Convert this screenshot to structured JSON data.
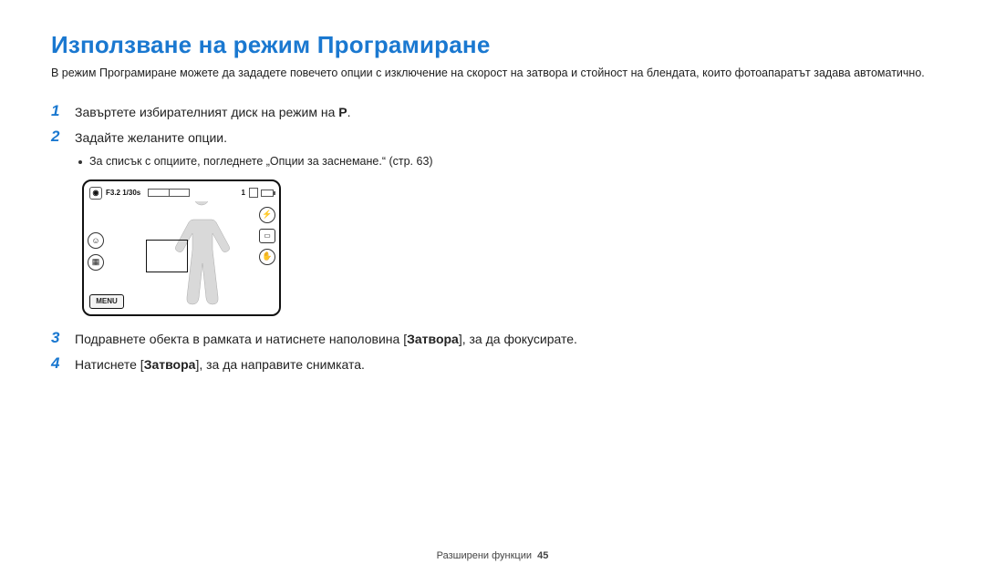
{
  "title": "Използване на режим Програмиране",
  "intro": "В режим Програмиране можете да зададете повечето опции с изключение на скорост на затвора и стойност на блендата, които фотоапаратът задава автоматично.",
  "steps": {
    "s1_num": "1",
    "s1_text_a": "Завъртете избирателният диск на режим на ",
    "s1_icon": "P",
    "s1_text_b": ".",
    "s2_num": "2",
    "s2_text": "Задайте желаните опции.",
    "s2_bullet": "За списък с опциите, погледнете „Опции за заснемане.“ (стр. 63)",
    "s3_num": "3",
    "s3_text_a": "Подравнете обекта в рамката и натиснете наполовина [",
    "s3_bold": "Затвора",
    "s3_text_b": "], за да фокусирате.",
    "s4_num": "4",
    "s4_text_a": "Натиснете [",
    "s4_bold": "Затвора",
    "s4_text_b": "], за да направите снимката."
  },
  "lcd": {
    "exposure": "F3.2 1/30s",
    "count": "1",
    "menu": "MENU"
  },
  "footer": {
    "section": "Разширени функции",
    "page": "45"
  }
}
